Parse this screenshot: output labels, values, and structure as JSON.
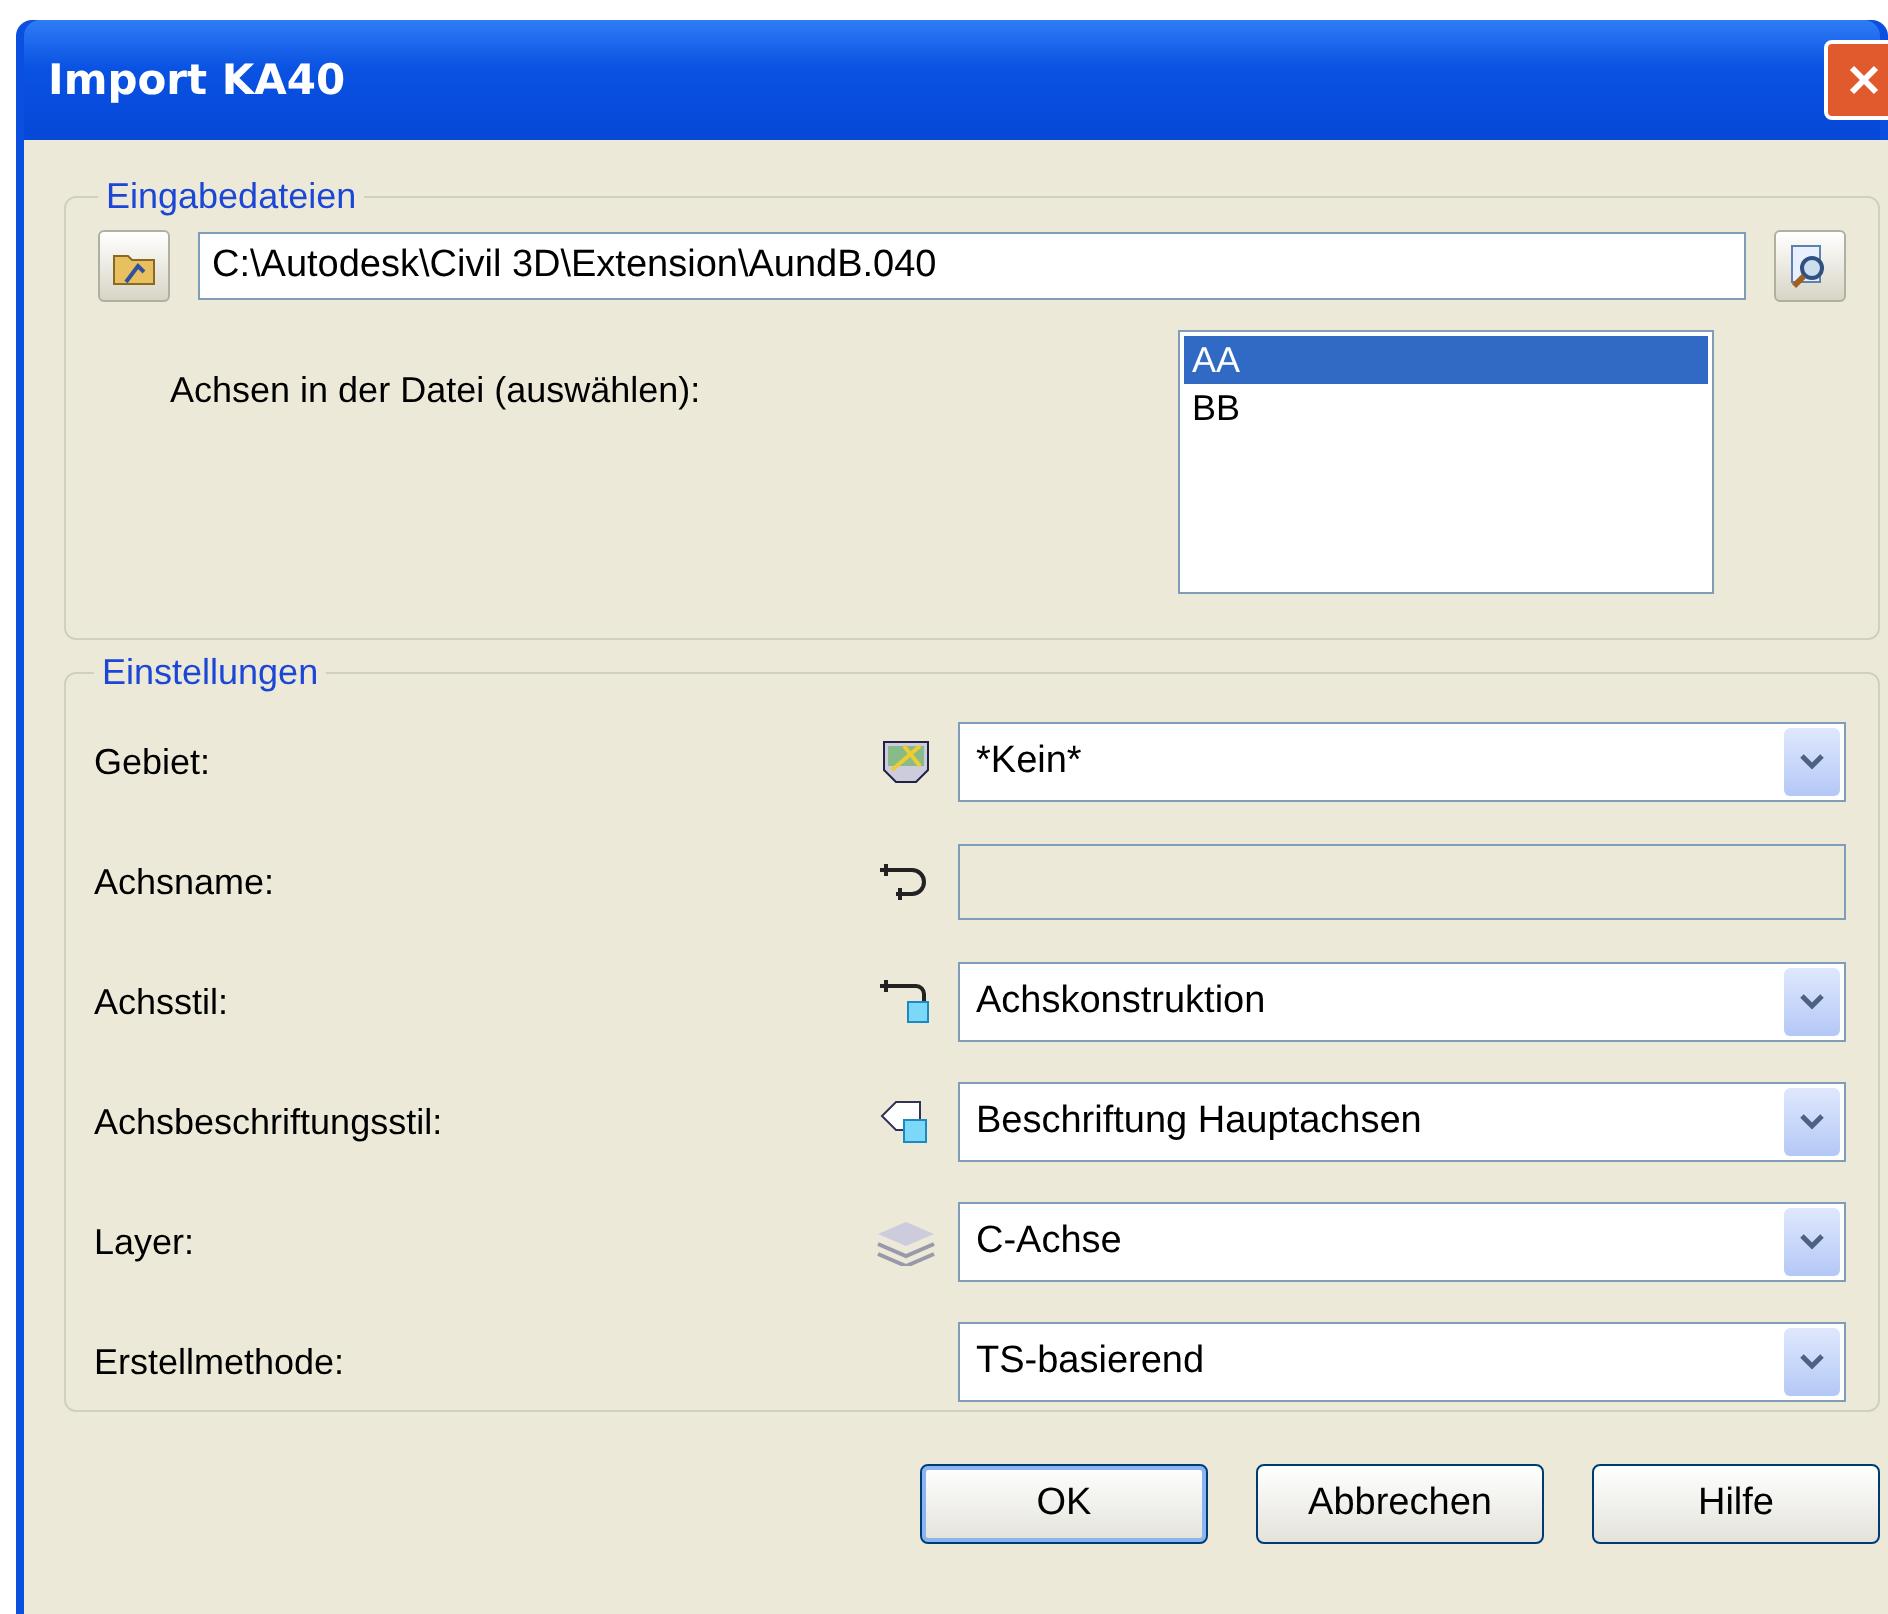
{
  "window": {
    "title": "Import KA40"
  },
  "input_files": {
    "legend": "Eingabedateien",
    "path": "C:\\Autodesk\\Civil 3D\\Extension\\AundB.040",
    "axes_label": "Achsen in der Datei (auswählen):",
    "axes": [
      {
        "label": "AA",
        "selected": true
      },
      {
        "label": "BB",
        "selected": false
      }
    ]
  },
  "settings": {
    "legend": "Einstellungen",
    "rows": [
      {
        "label": "Gebiet:",
        "kind": "combo",
        "value": "*Kein*"
      },
      {
        "label": "Achsname:",
        "kind": "text",
        "disabled": true
      },
      {
        "label": "Achsstil:",
        "kind": "combo",
        "value": "Achskonstruktion"
      },
      {
        "label": "Achsbeschriftungsstil:",
        "kind": "combo",
        "value": "Beschriftung Hauptachsen"
      },
      {
        "label": "Layer:",
        "kind": "combo",
        "value": "C-Achse"
      },
      {
        "label": "Erstellmethode:",
        "kind": "combo",
        "value": "TS-basierend"
      }
    ]
  },
  "buttons": [
    {
      "label": "OK",
      "default": true
    },
    {
      "label": "Abbrechen",
      "default": false
    },
    {
      "label": "Hilfe",
      "default": false
    }
  ]
}
